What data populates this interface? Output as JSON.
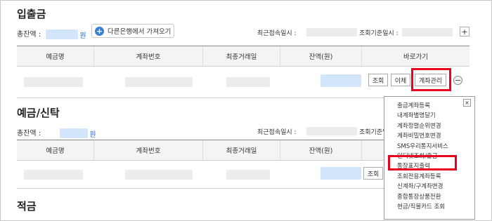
{
  "section1": {
    "title": "입출금",
    "total_label": "총잔액 :",
    "won": "원",
    "other_bank_button": "다른은행에서 가져오기",
    "last_login_label": "최근접속일시 :",
    "ref_date_label": "조회기준일시 :",
    "plus": "+",
    "columns": [
      "예금명",
      "계좌번호",
      "최종거래일",
      "잔액(원)",
      "바로가기"
    ],
    "row_buttons": {
      "inquiry": "조회",
      "transfer": "이체",
      "account_manage": "계좌관리"
    }
  },
  "section2": {
    "title": "예금/신탁",
    "total_label": "총잔액 :",
    "won": "원",
    "last_login_label": "최근접속일시 :",
    "ref_date_label": "조회기준일시 :",
    "columns": [
      "예금명",
      "계좌번호",
      "최종거래일",
      "잔액(원)",
      "바로가기"
    ],
    "row_buttons": {
      "inquiry": "조회"
    }
  },
  "section3": {
    "title": "적금"
  },
  "dropdown": {
    "close": "×",
    "items": [
      "출금계좌등록",
      "내계좌별명달기",
      "계좌정렬순위변경",
      "계좌비밀번호변경",
      "SMS우리통지서비스",
      "인터넷조회/출금",
      "통장표지출력",
      "조회전용계좌등록",
      "신계좌/구계좌변경",
      "종합통장상품전환",
      "현금/직불카드 조회"
    ]
  },
  "colors": {
    "highlight": "#e8001c",
    "accent": "#2a6ad8"
  }
}
